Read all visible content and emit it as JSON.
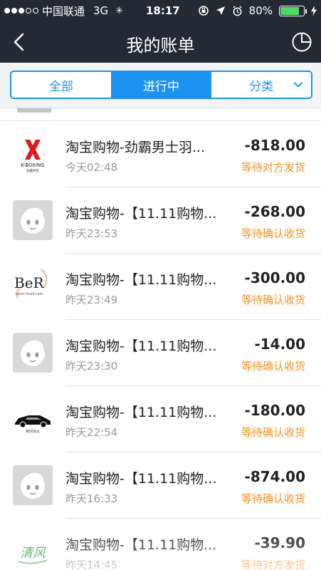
{
  "status_bar": {
    "carrier": "中国联通",
    "network": "3G",
    "time": "18:17",
    "battery_percent": "80%",
    "battery_level": 0.8
  },
  "nav": {
    "title": "我的账单"
  },
  "tabs": [
    {
      "label": "全部",
      "active": false
    },
    {
      "label": "进行中",
      "active": true
    },
    {
      "label": "分类",
      "active": false
    }
  ],
  "bills": [
    {
      "title": "淘宝购物-劲霸男士羽...",
      "time": "今天02:48",
      "amount": "-818.00",
      "status": "等待对方发货",
      "icon": "kboxing-logo-icon",
      "logo_text": "K-BOXING"
    },
    {
      "title": "淘宝购物-【11.11购物...",
      "time": "昨天23:53",
      "amount": "-268.00",
      "status": "等待确认收货",
      "icon": "default-avatar-icon"
    },
    {
      "title": "淘宝购物-【11.11购物...",
      "time": "昨天23:49",
      "amount": "-300.00",
      "status": "等待确认收货",
      "icon": "ber-logo-icon",
      "logo_text": "BeR",
      "logo_sub": "beixi.tmall.com"
    },
    {
      "title": "淘宝购物-【11.11购物...",
      "time": "昨天23:30",
      "amount": "-14.00",
      "status": "等待确认收货",
      "icon": "default-avatar-icon"
    },
    {
      "title": "淘宝购物-【11.11购物...",
      "time": "昨天22:54",
      "amount": "-180.00",
      "status": "等待确认收货",
      "icon": "koolu-car-logo-icon",
      "logo_text": "KOOLU"
    },
    {
      "title": "淘宝购物-【11.11购物...",
      "time": "昨天16:33",
      "amount": "-874.00",
      "status": "等待确认收货",
      "icon": "default-avatar-icon"
    },
    {
      "title": "淘宝购物-【11.11购物...",
      "time": "昨天14:45",
      "amount": "-39.90",
      "status": "等待对方发货",
      "icon": "qingfeng-logo-icon",
      "logo_text": "清风"
    }
  ],
  "colors": {
    "header_bg": "#252933",
    "accent": "#1d93f0",
    "status_orange": "#f39223"
  }
}
